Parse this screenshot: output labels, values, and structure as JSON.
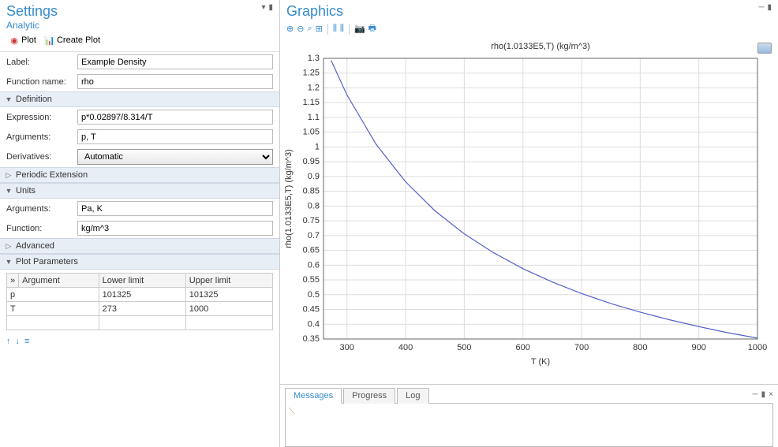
{
  "settings": {
    "title": "Settings",
    "subtitle": "Analytic",
    "toolbar": {
      "plot": "Plot",
      "create_plot": "Create Plot"
    },
    "label_lbl": "Label:",
    "label_val": "Example Density",
    "fname_lbl": "Function name:",
    "fname_val": "rho",
    "sections": {
      "definition": "Definition",
      "periodic": "Periodic Extension",
      "units": "Units",
      "advanced": "Advanced",
      "plotparams": "Plot Parameters"
    },
    "definition": {
      "expr_lbl": "Expression:",
      "expr_val": "p*0.02897/8.314/T",
      "args_lbl": "Arguments:",
      "args_val": "p, T",
      "deriv_lbl": "Derivatives:",
      "deriv_val": "Automatic"
    },
    "units": {
      "args_lbl": "Arguments:",
      "args_val": "Pa, K",
      "func_lbl": "Function:",
      "func_val": "kg/m^3"
    },
    "plotparams": {
      "cols": [
        "Argument",
        "Lower limit",
        "Upper limit"
      ],
      "rows": [
        {
          "arg": "p",
          "low": "101325",
          "high": "101325"
        },
        {
          "arg": "T",
          "low": "273",
          "high": "1000"
        }
      ]
    }
  },
  "graphics": {
    "title": "Graphics",
    "chart_title": "rho(1.0133E5,T) (kg/m^3)",
    "xlabel": "T (K)",
    "ylabel": "rho(1.0133E5,T) (kg/m^3)"
  },
  "chart_data": {
    "type": "line",
    "title": "rho(1.0133E5,T) (kg/m^3)",
    "xlabel": "T (K)",
    "ylabel": "rho(1.0133E5,T) (kg/m^3)",
    "xlim": [
      260,
      1000
    ],
    "ylim": [
      0.35,
      1.3
    ],
    "xticks": [
      300,
      400,
      500,
      600,
      700,
      800,
      900,
      1000
    ],
    "yticks": [
      0.35,
      0.4,
      0.45,
      0.5,
      0.55,
      0.6,
      0.65,
      0.7,
      0.75,
      0.8,
      0.85,
      0.9,
      0.95,
      1.0,
      1.05,
      1.1,
      1.15,
      1.2,
      1.25,
      1.3
    ],
    "x": [
      273,
      300,
      350,
      400,
      450,
      500,
      550,
      600,
      650,
      700,
      750,
      800,
      850,
      900,
      950,
      1000
    ],
    "y": [
      1.293,
      1.176,
      1.008,
      0.882,
      0.784,
      0.706,
      0.642,
      0.588,
      0.543,
      0.504,
      0.47,
      0.441,
      0.415,
      0.392,
      0.371,
      0.353
    ]
  },
  "bottom_tabs": {
    "messages": "Messages",
    "progress": "Progress",
    "log": "Log"
  }
}
